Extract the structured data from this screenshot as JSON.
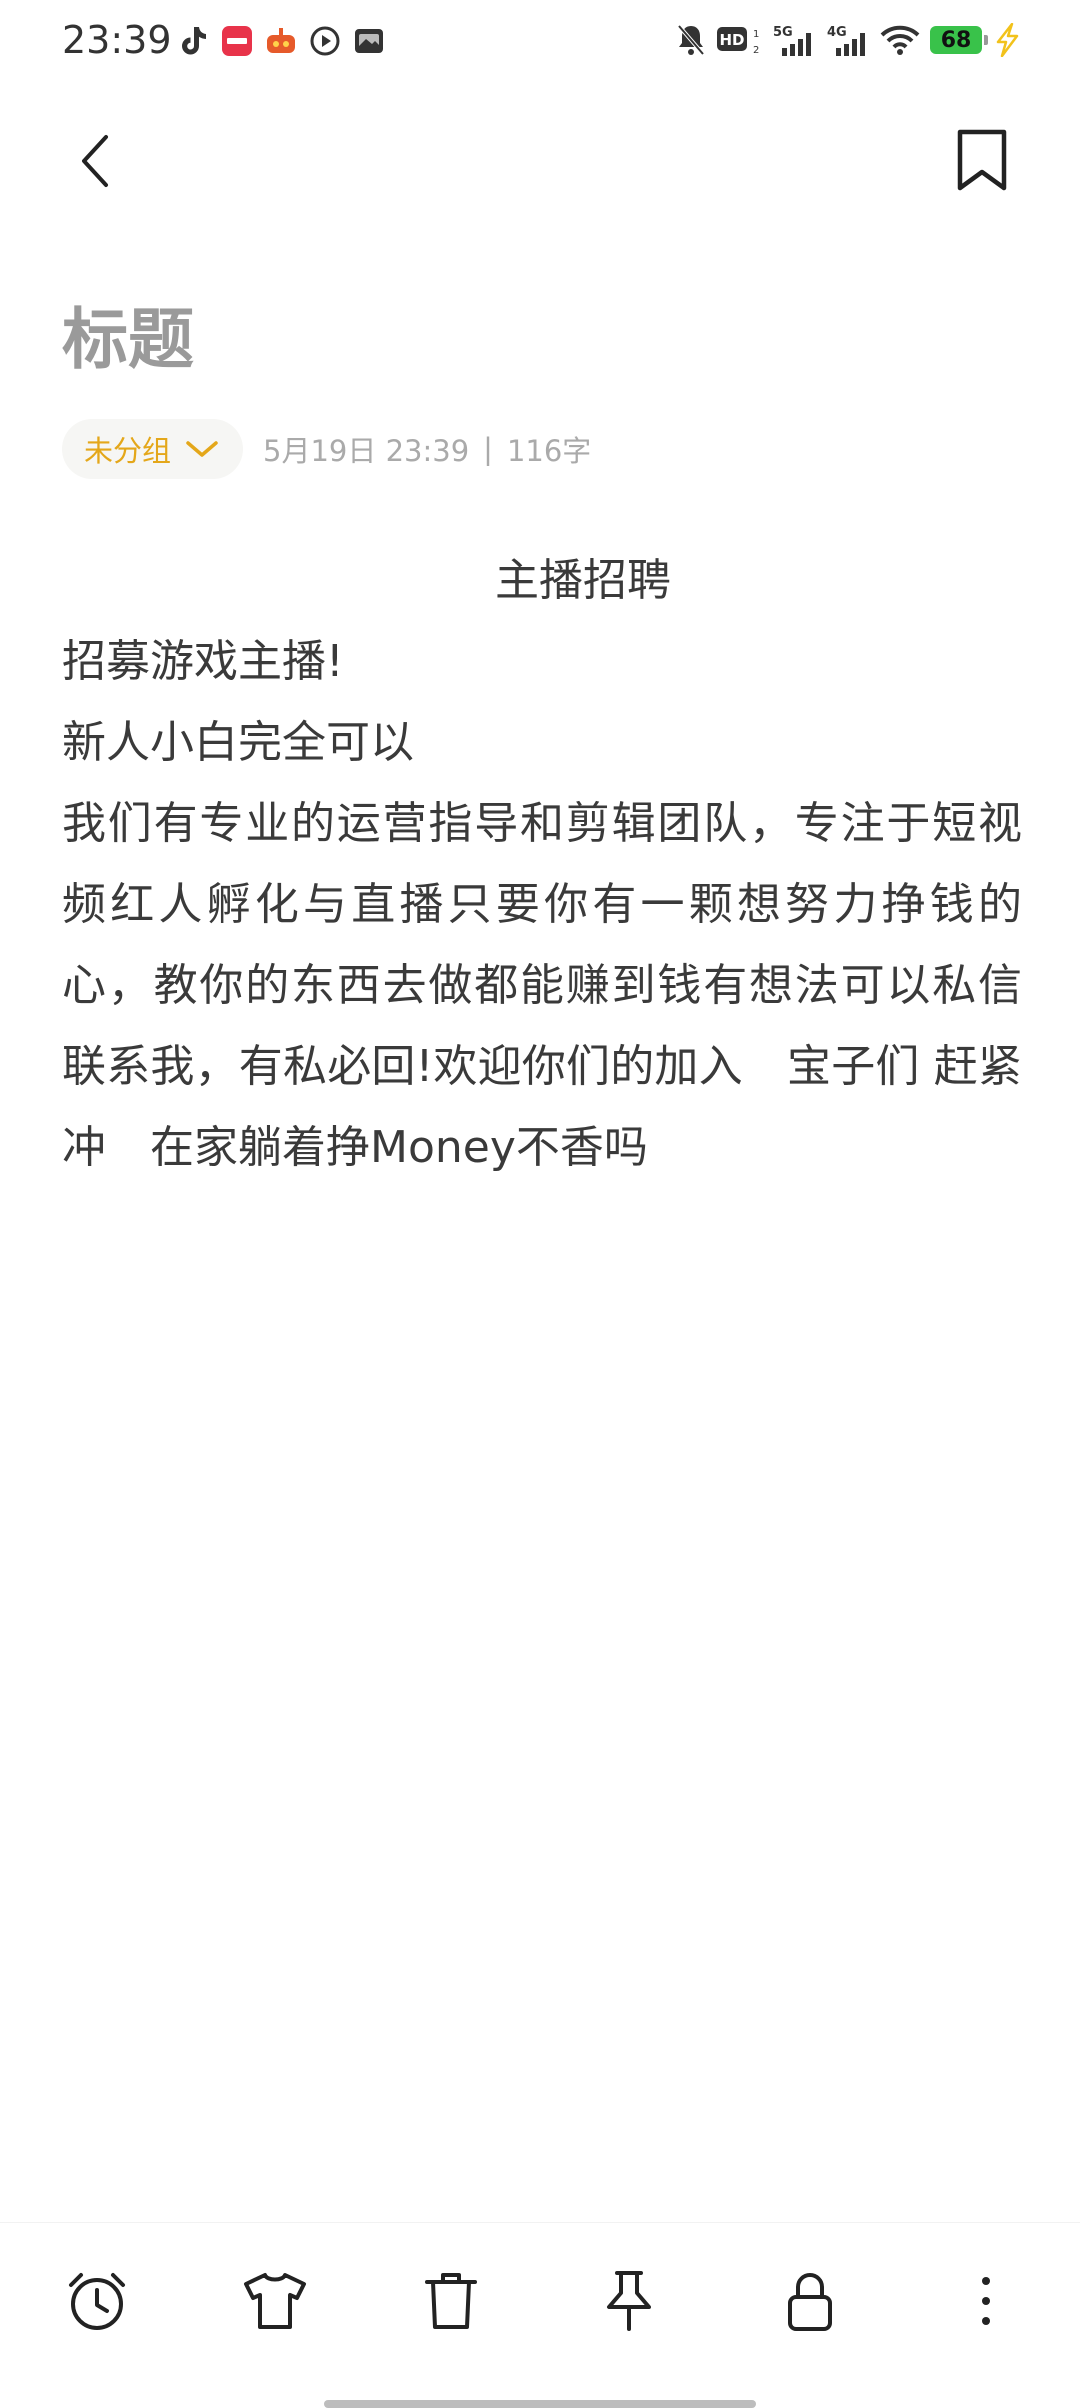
{
  "status_bar": {
    "time": "23:39",
    "battery_level": "68",
    "left_icons": [
      "tiktok-icon",
      "xiaohongshu-app-icon",
      "game-app-icon",
      "video-play-icon",
      "gallery-app-icon"
    ],
    "right_icons": [
      "mute-bell-icon",
      "hd-voice-icon",
      "signal-5g-icon",
      "signal-4g-icon",
      "wifi-icon",
      "battery-icon",
      "charging-icon"
    ],
    "hd_label": "HD",
    "net1": "5G",
    "net2": "4G",
    "battery_color": "#39c24a"
  },
  "note": {
    "title_placeholder": "标题",
    "group_label": "未分组",
    "date": "5月19日 23:39",
    "separator": "|",
    "char_count": "116字",
    "heading": "主播招聘",
    "line1": "招募游戏主播!",
    "line2": "新人小白完全可以",
    "paragraph": "我们有专业的运营指导和剪辑团队，专注于短视频红人孵化与直播只要你有一颗想努力挣钱的心，教你的东西去做都能赚到钱有想法可以私信联系我，有私必回!欢迎你们的加入　宝子们 赶紧冲　在家躺着挣Money不香吗"
  },
  "colors": {
    "accent": "#e4a71a",
    "title_placeholder": "#9a9a9a",
    "meta_text": "#aaaaaa",
    "body_text": "#3a3a3a"
  },
  "toolbar": {
    "items": [
      "alarm-clock-icon",
      "tshirt-icon",
      "trash-icon",
      "pin-icon",
      "lock-icon",
      "more-vertical-icon"
    ]
  }
}
